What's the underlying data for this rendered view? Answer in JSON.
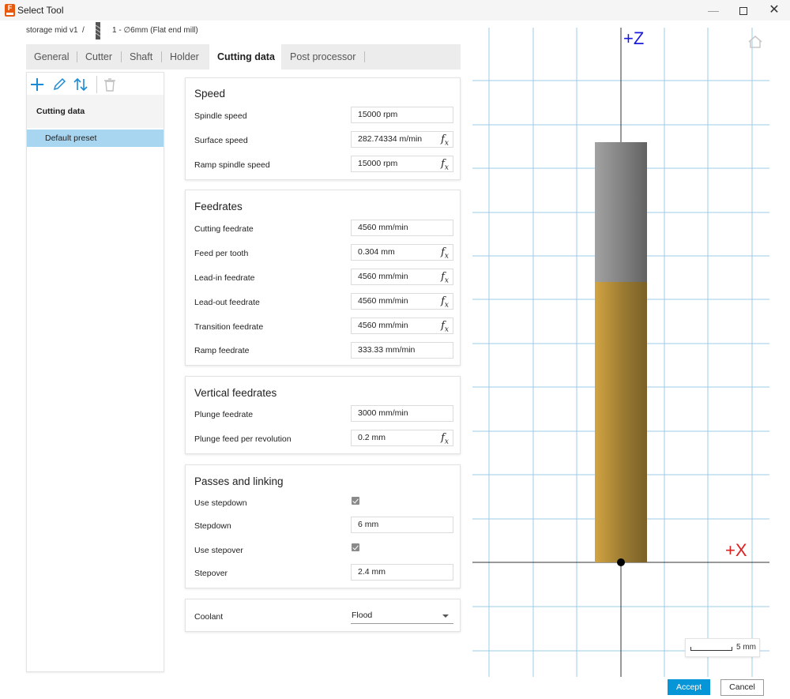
{
  "window": {
    "title": "Select Tool",
    "minimize": "—",
    "close": "✕"
  },
  "breadcrumb": {
    "document": "storage mid v1",
    "separator": "/",
    "tool": "1 - ∅6mm (Flat end mill)"
  },
  "tabs": [
    {
      "label": "General",
      "active": false
    },
    {
      "label": "Cutter",
      "active": false
    },
    {
      "label": "Shaft",
      "active": false
    },
    {
      "label": "Holder",
      "active": false
    },
    {
      "label": "Cutting data",
      "active": true
    },
    {
      "label": "Post processor",
      "active": false
    }
  ],
  "left_panel": {
    "header": "Cutting data",
    "presets": [
      "Default preset"
    ],
    "toolbar_icons": [
      "add-icon",
      "edit-icon",
      "sort-icon",
      "delete-icon"
    ]
  },
  "speed": {
    "title": "Speed",
    "spindle_speed": {
      "label": "Spindle speed",
      "value": "15000 rpm"
    },
    "surface_speed": {
      "label": "Surface speed",
      "value": "282.74334 m/min"
    },
    "ramp_spindle_speed": {
      "label": "Ramp spindle speed",
      "value": "15000 rpm"
    }
  },
  "feedrates": {
    "title": "Feedrates",
    "cutting_feedrate": {
      "label": "Cutting feedrate",
      "value": "4560 mm/min"
    },
    "feed_per_tooth": {
      "label": "Feed per tooth",
      "value": "0.304 mm"
    },
    "lead_in_feedrate": {
      "label": "Lead-in feedrate",
      "value": "4560 mm/min"
    },
    "lead_out_feedrate": {
      "label": "Lead-out feedrate",
      "value": "4560 mm/min"
    },
    "transition_feedrate": {
      "label": "Transition feedrate",
      "value": "4560 mm/min"
    },
    "ramp_feedrate": {
      "label": "Ramp feedrate",
      "value": "333.33 mm/min"
    }
  },
  "vertical_feedrates": {
    "title": "Vertical feedrates",
    "plunge_feedrate": {
      "label": "Plunge feedrate",
      "value": "3000 mm/min"
    },
    "plunge_feed_per_revolution": {
      "label": "Plunge feed per revolution",
      "value": "0.2 mm"
    }
  },
  "passes": {
    "title": "Passes and linking",
    "use_stepdown": {
      "label": "Use stepdown",
      "checked": true
    },
    "stepdown": {
      "label": "Stepdown",
      "value": "6 mm"
    },
    "use_stepover": {
      "label": "Use stepover",
      "checked": true
    },
    "stepover": {
      "label": "Stepover",
      "value": "2.4 mm"
    }
  },
  "coolant": {
    "label": "Coolant",
    "value": "Flood"
  },
  "fx_glyph": "f",
  "fx_sub": "x",
  "viewport": {
    "z_axis_label": "+Z",
    "x_axis_label": "+X",
    "scale_label": "5 mm",
    "z_color": "#1a1adc",
    "x_color": "#e02020",
    "holder_color": "#8a8a8a",
    "cutter_color": "#b8923a",
    "grid_color": "#9ccbe8"
  },
  "buttons": {
    "accept": "Accept",
    "cancel": "Cancel"
  }
}
